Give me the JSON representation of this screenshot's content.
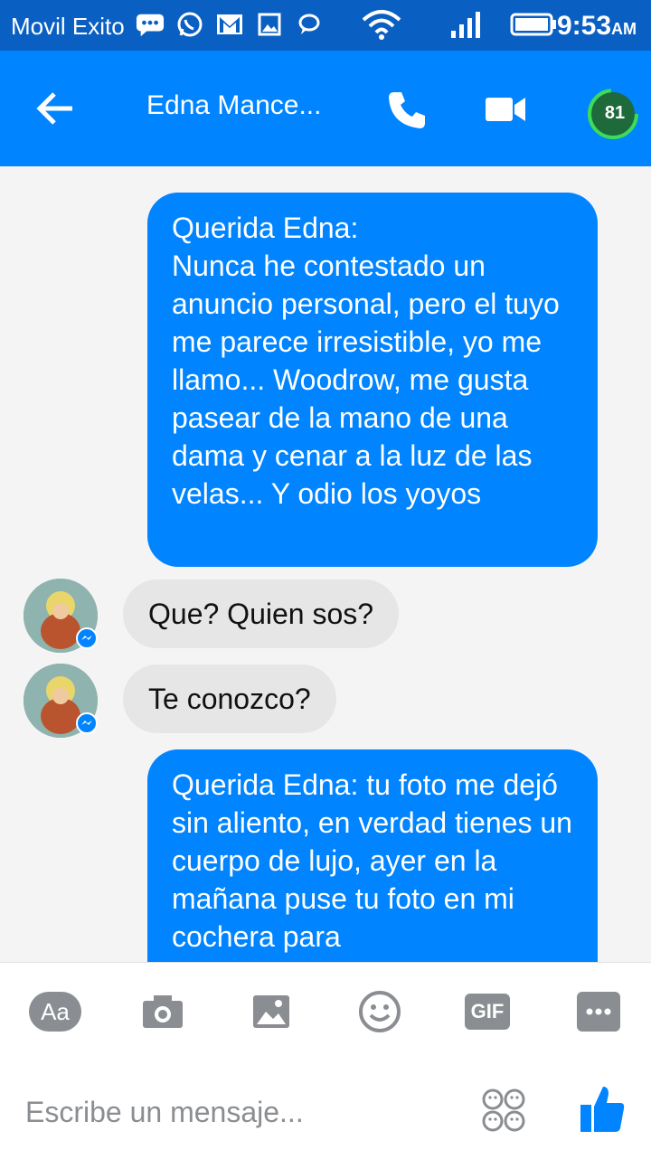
{
  "status_bar": {
    "carrier": "Movil Exito",
    "time": "9:53",
    "ampm": "AM",
    "icons": [
      "chat-bubble-dots-icon",
      "whatsapp-icon",
      "gmail-icon",
      "image-icon",
      "message-icon",
      "wifi-icon",
      "signal-icon",
      "battery-icon"
    ]
  },
  "header": {
    "contact_name": "Edna Mance...",
    "badge_count": "81",
    "icons": [
      "back-arrow-icon",
      "phone-icon",
      "video-camera-icon",
      "notification-badge-icon"
    ]
  },
  "messages": [
    {
      "direction": "out",
      "text": "Querida Edna:\nNunca he contestado un anuncio personal, pero el tuyo me parece irresistible, yo me llamo... Woodrow, me gusta pasear de la mano de una dama y cenar a la luz de las velas... Y odio los yoyos"
    },
    {
      "direction": "in",
      "text": "Que? Quien sos?"
    },
    {
      "direction": "in",
      "text": "Te conozco?"
    },
    {
      "direction": "out",
      "text": "Querida Edna: tu foto me dejó sin aliento, en verdad tienes un cuerpo de lujo, ayer en la mañana puse tu foto en mi cochera para"
    }
  ],
  "composer": {
    "aa_label": "Aa",
    "gif_label": "GIF",
    "placeholder": "Escribe un mensaje...",
    "icons": [
      "camera-icon",
      "gallery-icon",
      "emoji-icon",
      "more-icon",
      "stickers-icon",
      "thumbs-up-icon"
    ]
  },
  "colors": {
    "status_bar": "#0a5fc2",
    "app_bar": "#0084ff",
    "outgoing_bubble": "#0084ff",
    "incoming_bubble": "#e6e6e6",
    "background": "#f4f4f4"
  }
}
